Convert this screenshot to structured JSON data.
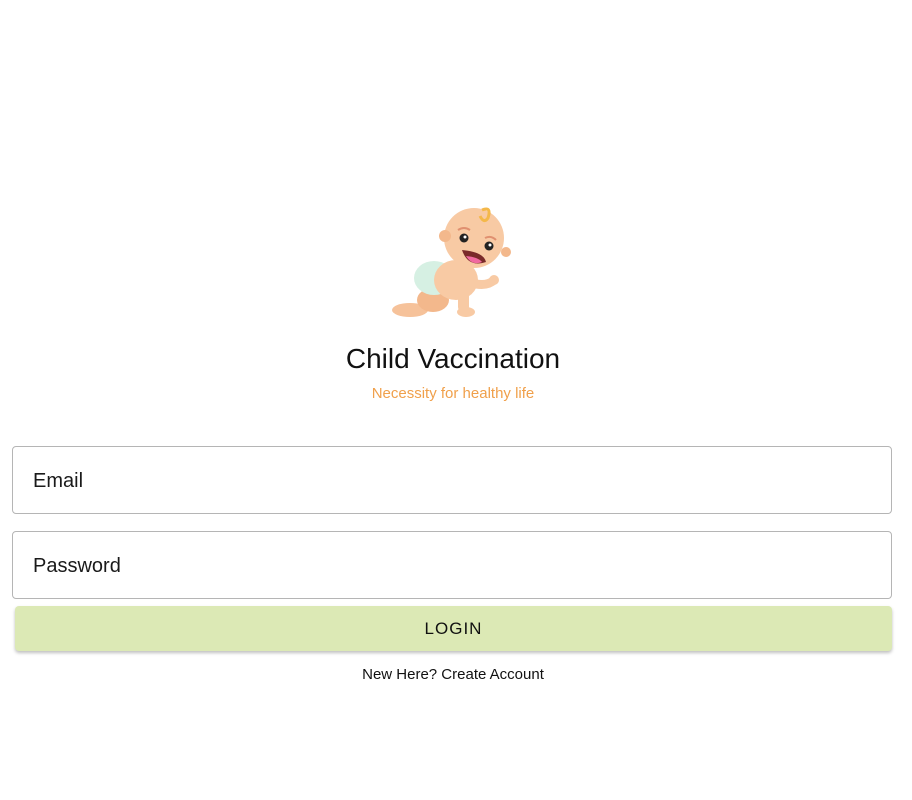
{
  "header": {
    "logo_icon": "crawling-baby-icon",
    "title": "Child Vaccination",
    "subtitle": "Necessity for healthy life"
  },
  "form": {
    "email_label": "Email",
    "email_value": "",
    "password_label": "Password",
    "password_value": "",
    "login_label": "LOGIN"
  },
  "footer": {
    "create_account_text": "New Here? Create Account"
  },
  "colors": {
    "subtitle": "#f0a04b",
    "login_button": "#dce9b5",
    "field_border": "#b5b5b5"
  }
}
